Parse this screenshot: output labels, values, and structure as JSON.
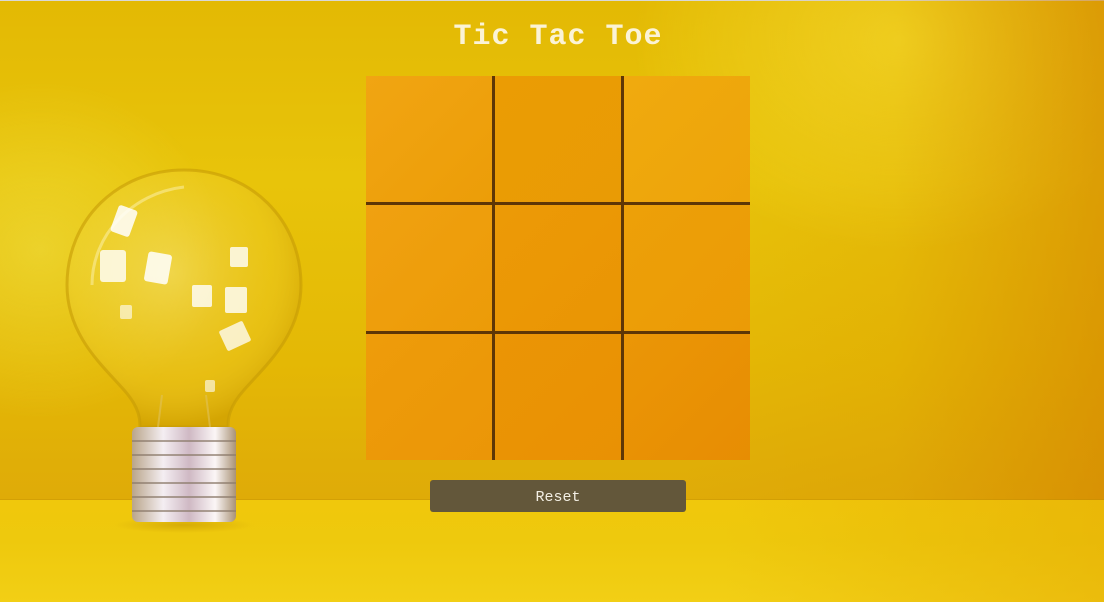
{
  "title": "Tic Tac Toe",
  "board": {
    "cells": [
      "",
      "",
      "",
      "",
      "",
      "",
      "",
      "",
      ""
    ]
  },
  "controls": {
    "reset_label": "Reset"
  },
  "colors": {
    "background": "#e6bd06",
    "board_grid": "#5e3606",
    "cell": "#ec9c08",
    "button": "#63573a",
    "button_text": "#f3efe4",
    "title_text": "#fbf3d6"
  },
  "decoration": {
    "background_image": "light-bulb-icon"
  }
}
